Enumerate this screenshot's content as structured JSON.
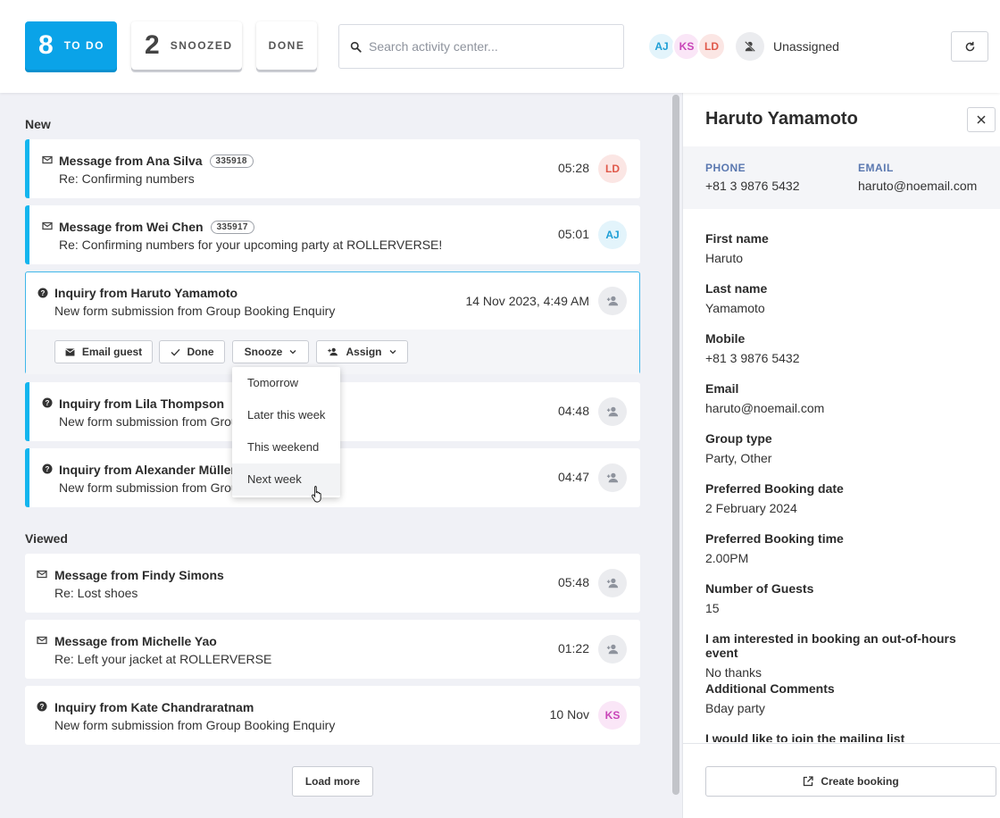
{
  "header": {
    "todo": {
      "count": "8",
      "label": "TO DO"
    },
    "snoozed": {
      "count": "2",
      "label": "SNOOZED"
    },
    "done": {
      "label": "DONE"
    },
    "search_placeholder": "Search activity center...",
    "avatars": [
      "AJ",
      "KS",
      "LD"
    ],
    "unassigned_label": "Unassigned"
  },
  "sections": {
    "new": "New",
    "viewed": "Viewed"
  },
  "new_items": [
    {
      "title": "Message from Ana Silva",
      "badge": "335918",
      "subtitle": "Re: Confirming numbers",
      "time": "05:28",
      "assignee": "LD"
    },
    {
      "title": "Message from Wei Chen",
      "badge": "335917",
      "subtitle": "Re: Confirming numbers for your upcoming party at ROLLERVERSE!",
      "time": "05:01",
      "assignee": "AJ"
    },
    {
      "title": "Inquiry from Lila Thompson",
      "subtitle": "New form submission from Group Booking Enquiry",
      "time": "04:48"
    },
    {
      "title": "Inquiry from Alexander Müller",
      "subtitle": "New form submission from Group Booking Enquiry",
      "time": "04:47"
    }
  ],
  "expanded_item": {
    "title": "Inquiry from Haruto Yamamoto",
    "subtitle": "New form submission from Group Booking Enquiry",
    "time": "14 Nov 2023, 4:49 AM",
    "actions": {
      "email": "Email guest",
      "done": "Done",
      "snooze": "Snooze",
      "assign": "Assign"
    }
  },
  "snooze_options": [
    "Tomorrow",
    "Later this week",
    "This weekend",
    "Next week"
  ],
  "viewed_items": [
    {
      "title": "Message from Findy Simons",
      "subtitle": "Re: Lost shoes",
      "time": "05:48"
    },
    {
      "title": "Message from Michelle Yao",
      "subtitle": "Re: Left your jacket at ROLLERVERSE",
      "time": "01:22"
    },
    {
      "title": "Inquiry from Kate Chandraratnam",
      "subtitle": "New form submission from Group Booking Enquiry",
      "time": "10 Nov",
      "assignee": "KS"
    }
  ],
  "load_more": "Load more",
  "panel": {
    "name": "Haruto Yamamoto",
    "phone_label": "PHONE",
    "phone": "+81 3 9876 5432",
    "email_label": "EMAIL",
    "email": "haruto@noemail.com",
    "fields": [
      {
        "label": "First name",
        "value": "Haruto"
      },
      {
        "label": "Last name",
        "value": "Yamamoto"
      },
      {
        "label": "Mobile",
        "value": "+81 3 9876 5432"
      },
      {
        "label": "Email",
        "value": "haruto@noemail.com"
      },
      {
        "label": "Group type",
        "value": "Party, Other"
      },
      {
        "label": "Preferred Booking date",
        "value": "2 February 2024"
      },
      {
        "label": "Preferred Booking time",
        "value": "2.00PM"
      },
      {
        "label": "Number of Guests",
        "value": "15"
      },
      {
        "label": "I am interested in booking an out-of-hours event",
        "value": "No thanks"
      },
      {
        "label": "Additional Comments",
        "value": "Bday party"
      },
      {
        "label": "I would like to join the mailing list",
        "value": ""
      }
    ],
    "create_booking": "Create booking"
  },
  "colors": {
    "accent": "#0aa3e8",
    "new_bar": "#12b5ee",
    "label_blue": "#5a78b0"
  }
}
